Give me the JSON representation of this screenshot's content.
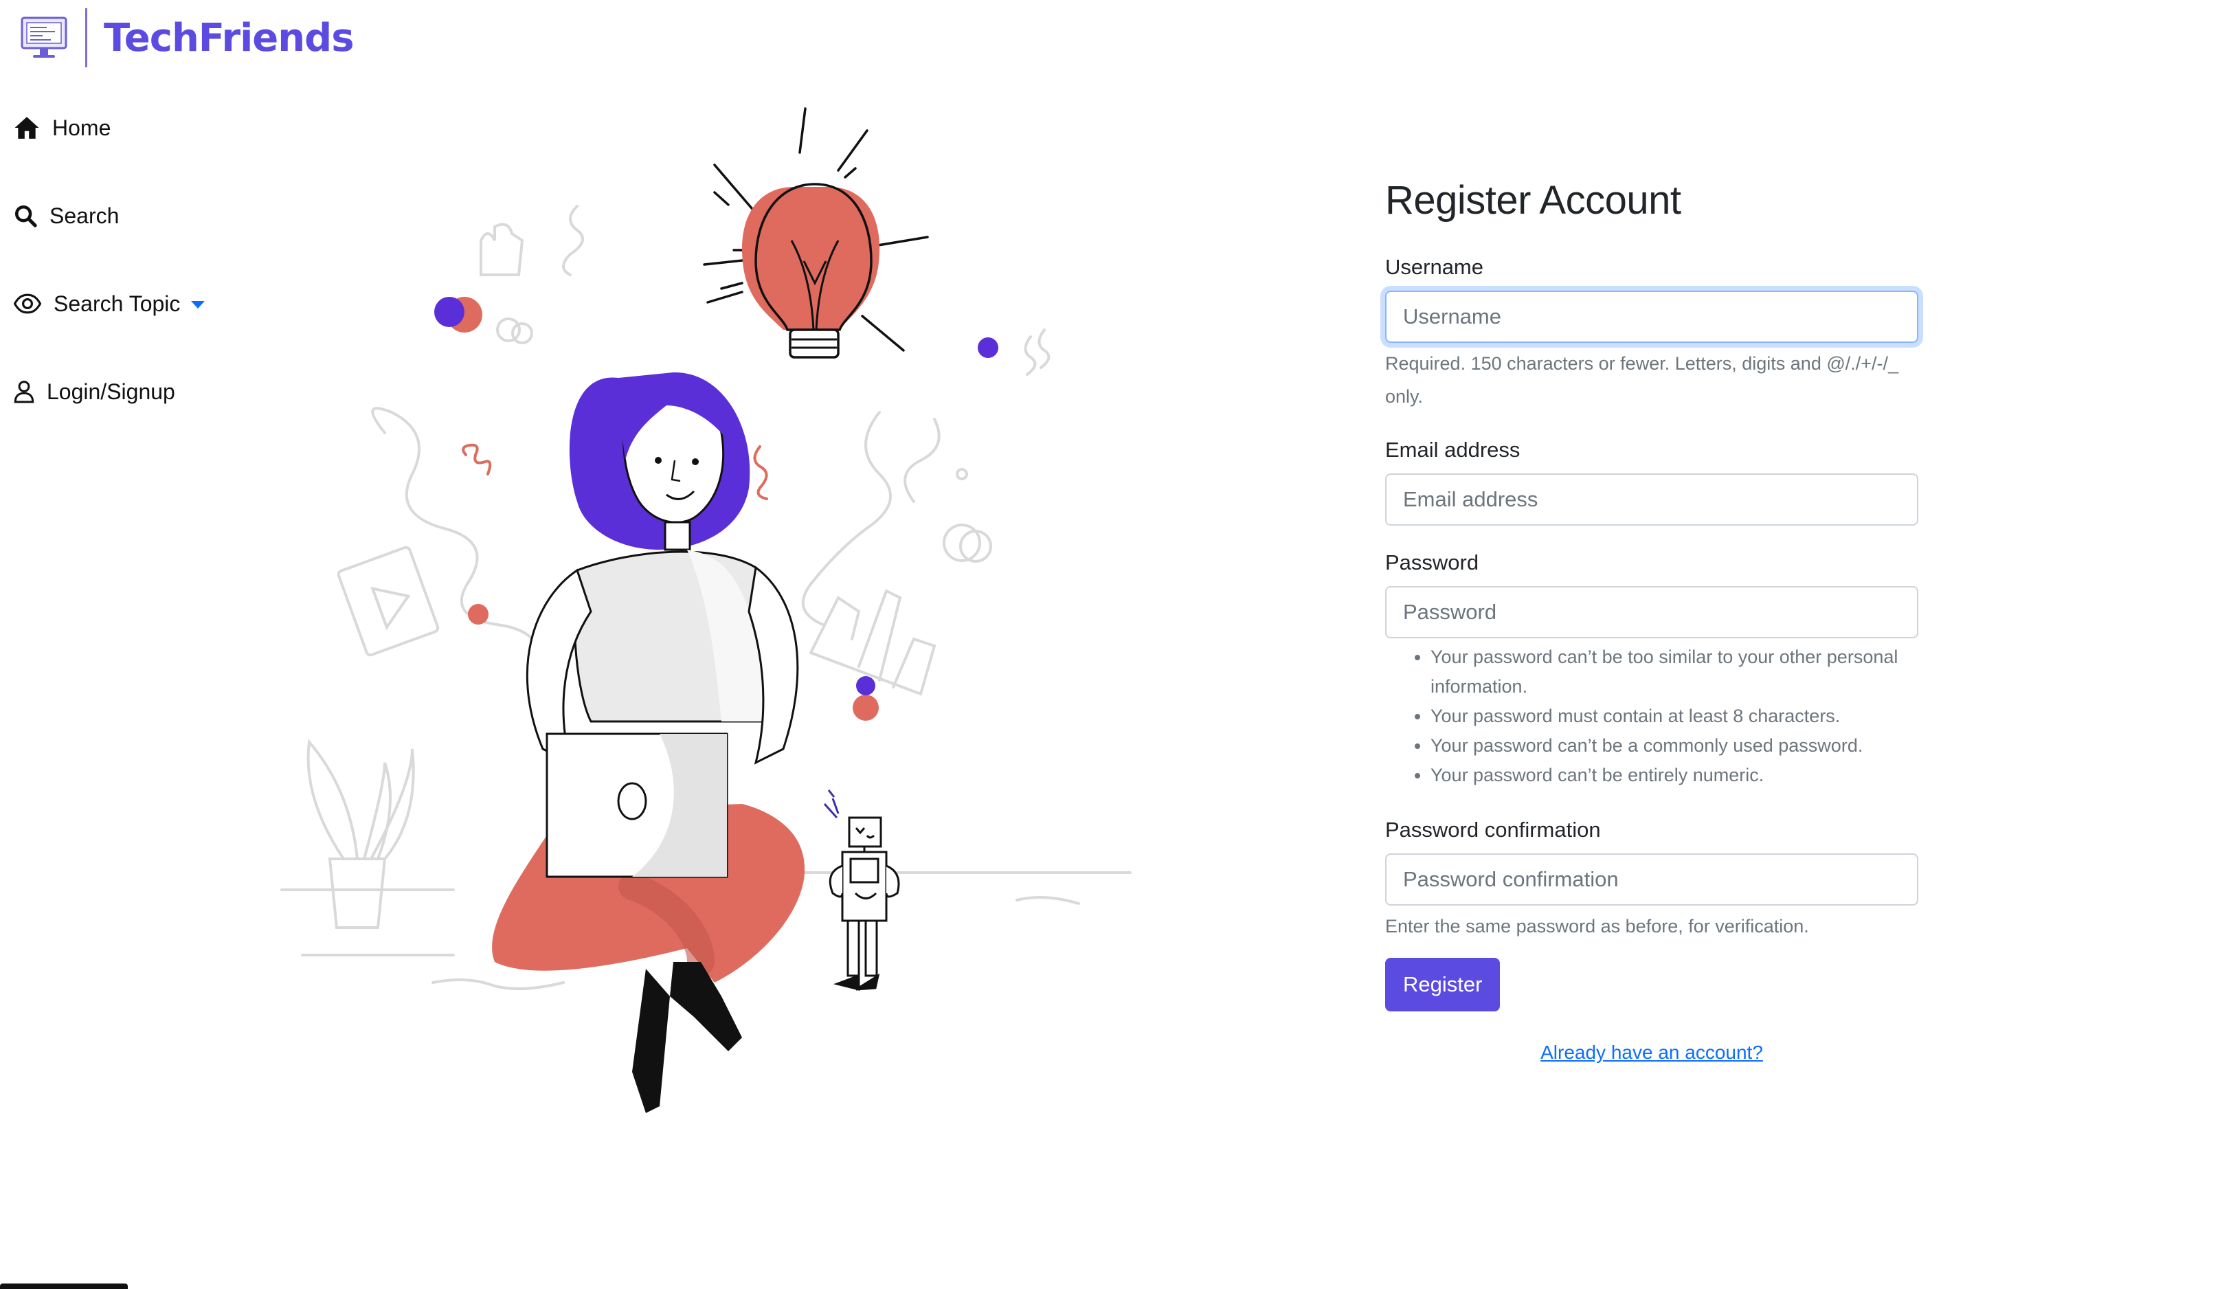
{
  "brand": {
    "name": "TechFriends",
    "logo_icon": "monitor-logo-icon",
    "color": "#5b4be0"
  },
  "sidebar": {
    "items": [
      {
        "label": "Home",
        "icon": "home-icon"
      },
      {
        "label": "Search",
        "icon": "search-icon"
      },
      {
        "label": "Search Topic",
        "icon": "eye-icon",
        "has_dropdown": true
      },
      {
        "label": "Login/Signup",
        "icon": "user-icon"
      }
    ]
  },
  "form": {
    "title": "Register Account",
    "username": {
      "label": "Username",
      "placeholder": "Username",
      "value": "",
      "help": "Required. 150 characters or fewer. Letters, digits and @/./+/-/_ only."
    },
    "email": {
      "label": "Email address",
      "placeholder": "Email address",
      "value": ""
    },
    "password": {
      "label": "Password",
      "placeholder": "Password",
      "value": "",
      "rules": [
        "Your password can’t be too similar to your other personal information.",
        "Your password must contain at least 8 characters.",
        "Your password can’t be a commonly used password.",
        "Your password can’t be entirely numeric."
      ]
    },
    "password_confirmation": {
      "label": "Password confirmation",
      "placeholder": "Password confirmation",
      "value": "",
      "help": "Enter the same password as before, for verification."
    },
    "submit_label": "Register",
    "login_link": "Already have an account?"
  },
  "colors": {
    "accent": "#5b4be0",
    "illustration_red": "#de6b5e",
    "illustration_purple": "#5b2fd8",
    "link": "#0d6efd"
  }
}
